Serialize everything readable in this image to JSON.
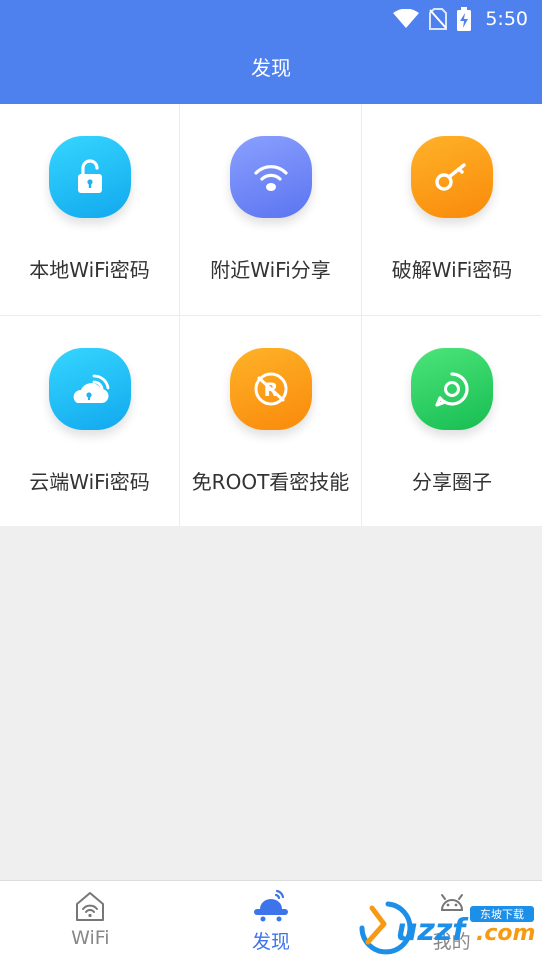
{
  "status_bar": {
    "time": "5:50",
    "icons": [
      "wifi-signal-icon",
      "no-sim-icon",
      "battery-charging-icon"
    ]
  },
  "header": {
    "title": "发现"
  },
  "grid": {
    "items": [
      {
        "label": "本地WiFi密码",
        "icon": "unlock-icon",
        "color": "#1fb9f5"
      },
      {
        "label": "附近WiFi分享",
        "icon": "wifi-icon",
        "color": "#6e86f5"
      },
      {
        "label": "破解WiFi密码",
        "icon": "key-icon",
        "color": "#fb9a14"
      },
      {
        "label": "云端WiFi密码",
        "icon": "cloud-wifi-icon",
        "color": "#1fb9f5"
      },
      {
        "label": "免ROOT看密技能",
        "icon": "no-root-icon",
        "color": "#fb9a14"
      },
      {
        "label": "分享圈子",
        "icon": "chat-circle-icon",
        "color": "#28cd62"
      }
    ]
  },
  "bottom_nav": {
    "tabs": [
      {
        "label": "WiFi",
        "icon": "house-wifi-icon",
        "active": false
      },
      {
        "label": "发现",
        "icon": "ufo-icon",
        "active": true
      },
      {
        "label": "我的",
        "icon": "android-icon",
        "active": false
      }
    ],
    "accent": "#3d74ec"
  },
  "watermark": {
    "text": "uzzf.com",
    "subtext": "东坡下载"
  }
}
